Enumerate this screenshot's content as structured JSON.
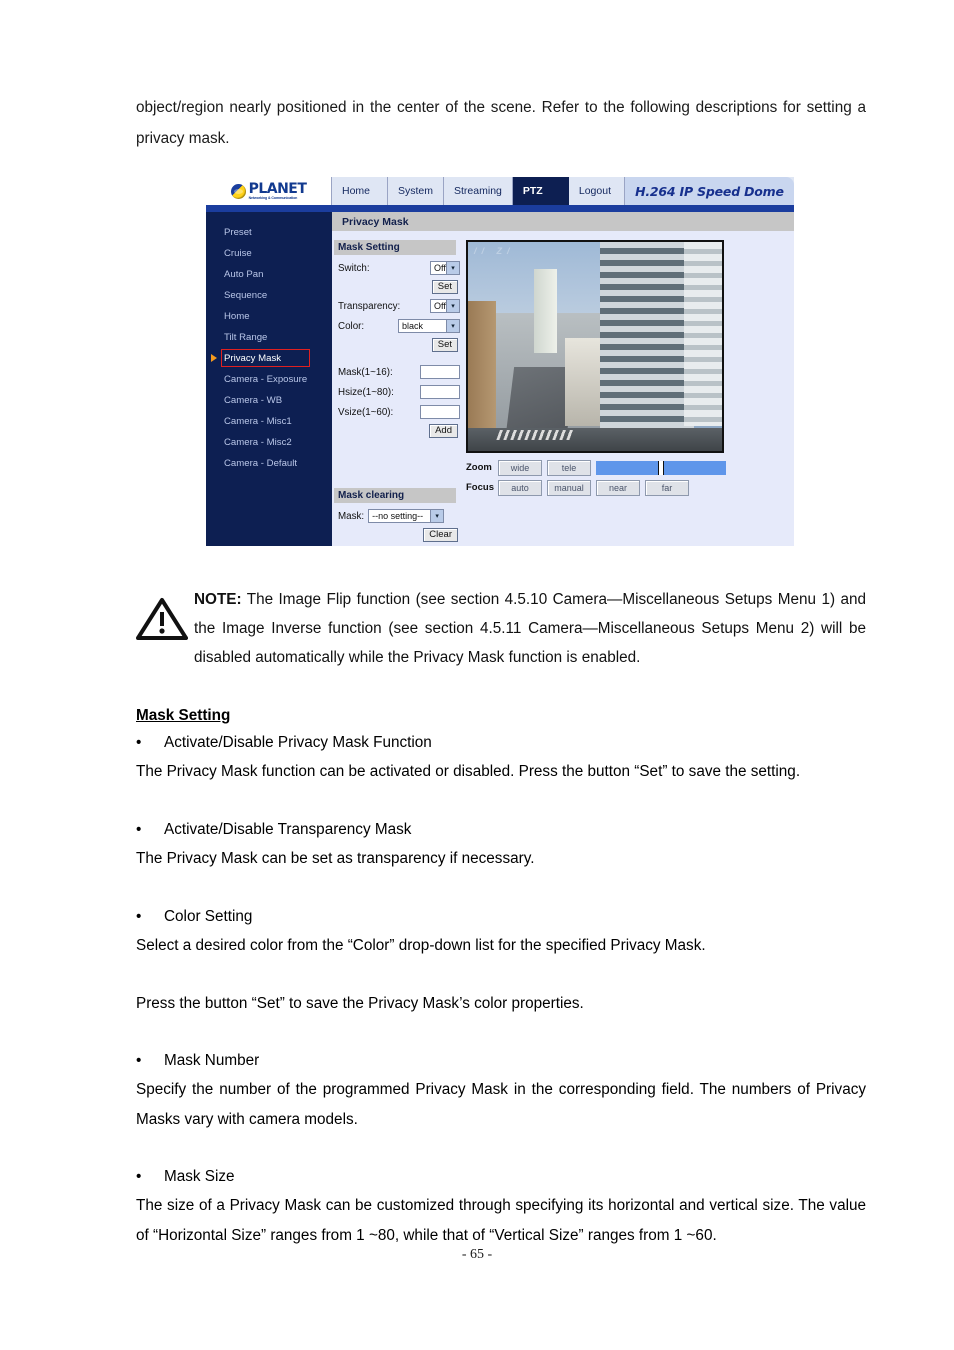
{
  "document": {
    "intro_paragraph": "object/region nearly positioned in the center of the scene. Refer to the following descriptions for setting a privacy mask.",
    "note": {
      "label": "NOTE:",
      "text": " The Image Flip function (see section 4.5.10 Camera—Miscellaneous Setups Menu 1) and the Image Inverse function (see section 4.5.11 Camera—Miscellaneous Setups Menu 2) will be disabled automatically while the Privacy Mask function is enabled.",
      "icon": "warning-triangle-icon"
    },
    "section_heading": "Mask Setting",
    "bullets": [
      {
        "title": "Activate/Disable Privacy Mask Function",
        "body": "The Privacy Mask function can be activated or disabled. Press the button “Set” to save the setting."
      },
      {
        "title": "Activate/Disable Transparency Mask",
        "body": "The Privacy Mask can be set as transparency if necessary."
      },
      {
        "title": "Color Setting",
        "body": "Select a desired color from the “Color” drop-down list for the specified Privacy Mask.",
        "body2": "Press the button “Set” to save the Privacy Mask’s color properties."
      },
      {
        "title": "Mask Number",
        "body": "Specify the number of the programmed Privacy Mask in the corresponding field. The numbers of Privacy Masks vary with camera models."
      },
      {
        "title": "Mask Size",
        "body": "The size of a Privacy Mask can be customized through specifying its horizontal and vertical size. The value of “Horizontal Size” ranges from 1 ~80, while that of “Vertical Size” ranges from 1 ~60."
      }
    ],
    "page_number": "- 65 -"
  },
  "screenshot": {
    "logo": {
      "name": "PLANET",
      "tagline": "Networking & Communication"
    },
    "nav": [
      {
        "label": "Home",
        "active": false
      },
      {
        "label": "System",
        "active": false
      },
      {
        "label": "Streaming",
        "active": false
      },
      {
        "label": "PTZ",
        "active": true
      },
      {
        "label": "Logout",
        "active": false
      }
    ],
    "brand": "H.264 IP Speed Dome",
    "sidebar": {
      "items": [
        {
          "label": "Preset",
          "selected": false
        },
        {
          "label": "Cruise",
          "selected": false
        },
        {
          "label": "Auto Pan",
          "selected": false
        },
        {
          "label": "Sequence",
          "selected": false
        },
        {
          "label": "Home",
          "selected": false
        },
        {
          "label": "Tilt Range",
          "selected": false
        },
        {
          "label": "Privacy Mask",
          "selected": true
        },
        {
          "label": "Camera - Exposure",
          "selected": false
        },
        {
          "label": "Camera - WB",
          "selected": false
        },
        {
          "label": "Camera - Misc1",
          "selected": false
        },
        {
          "label": "Camera - Misc2",
          "selected": false
        },
        {
          "label": "Camera - Default",
          "selected": false
        }
      ]
    },
    "page_title": "Privacy Mask",
    "mask_setting": {
      "group_title": "Mask Setting",
      "switch_label": "Switch:",
      "switch_value": "Off",
      "set_button_1": "Set",
      "transparency_label": "Transparency:",
      "transparency_value": "Off",
      "color_label": "Color:",
      "color_value": "black",
      "set_button_2": "Set",
      "mask_label": "Mask(1~16):",
      "mask_value": "",
      "hsize_label": "Hsize(1~80):",
      "hsize_value": "",
      "vsize_label": "Vsize(1~60):",
      "vsize_value": "",
      "add_button": "Add"
    },
    "mask_clearing": {
      "group_title": "Mask clearing",
      "mask_label": "Mask:",
      "mask_value": "--no setting--",
      "clear_button": "Clear"
    },
    "video": {
      "overlay_text": "// Z/"
    },
    "ptz_controls": {
      "zoom_label": "Zoom",
      "zoom_buttons": [
        "wide",
        "tele"
      ],
      "focus_label": "Focus",
      "focus_buttons": [
        "auto",
        "manual",
        "near",
        "far"
      ]
    },
    "colors": {
      "sidebar_bg": "#0d1f52",
      "nav_active": "#0d1f52",
      "content_bg": "#e6eafa",
      "group_header": "#c6c6c6",
      "accent_blue": "#1b3d9e",
      "selection_red": "#e02020",
      "pointer_orange": "#f59a1e",
      "slider_blue": "#5f96ea"
    }
  }
}
